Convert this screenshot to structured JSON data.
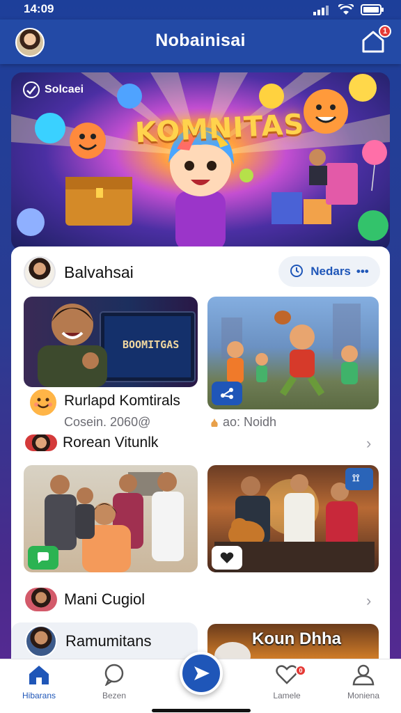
{
  "status_bar": {
    "time": "14:09"
  },
  "header": {
    "title": "Nobainisai",
    "notification_count": "1"
  },
  "hero": {
    "chip_label": "Solcaei",
    "title": "KOMNITAS"
  },
  "section1": {
    "title": "Balvahsai",
    "action_label": "Nedars",
    "action_more": "•••"
  },
  "cards": [
    {
      "screen_text": "BOOMITGAS",
      "caption": "Rurlapd Komtirals",
      "sub": "Cosein. 2060@"
    },
    {
      "sub": "ao: Noidh"
    }
  ],
  "section2": {
    "title": "Rorean Vitunlk"
  },
  "section3": {
    "title": "Mani Cugiol"
  },
  "section4": {
    "title": "Ramumitans",
    "thumb_text": "Koun Dhha"
  },
  "bottom_nav": {
    "items": [
      {
        "label": "Hibarans"
      },
      {
        "label": "Bezen"
      },
      {
        "label": "Lamele"
      },
      {
        "label": "Moniena"
      }
    ],
    "likes_badge": "0"
  },
  "colors": {
    "brand": "#234aa6",
    "accent": "#1f56b8",
    "badge": "#e53935"
  }
}
